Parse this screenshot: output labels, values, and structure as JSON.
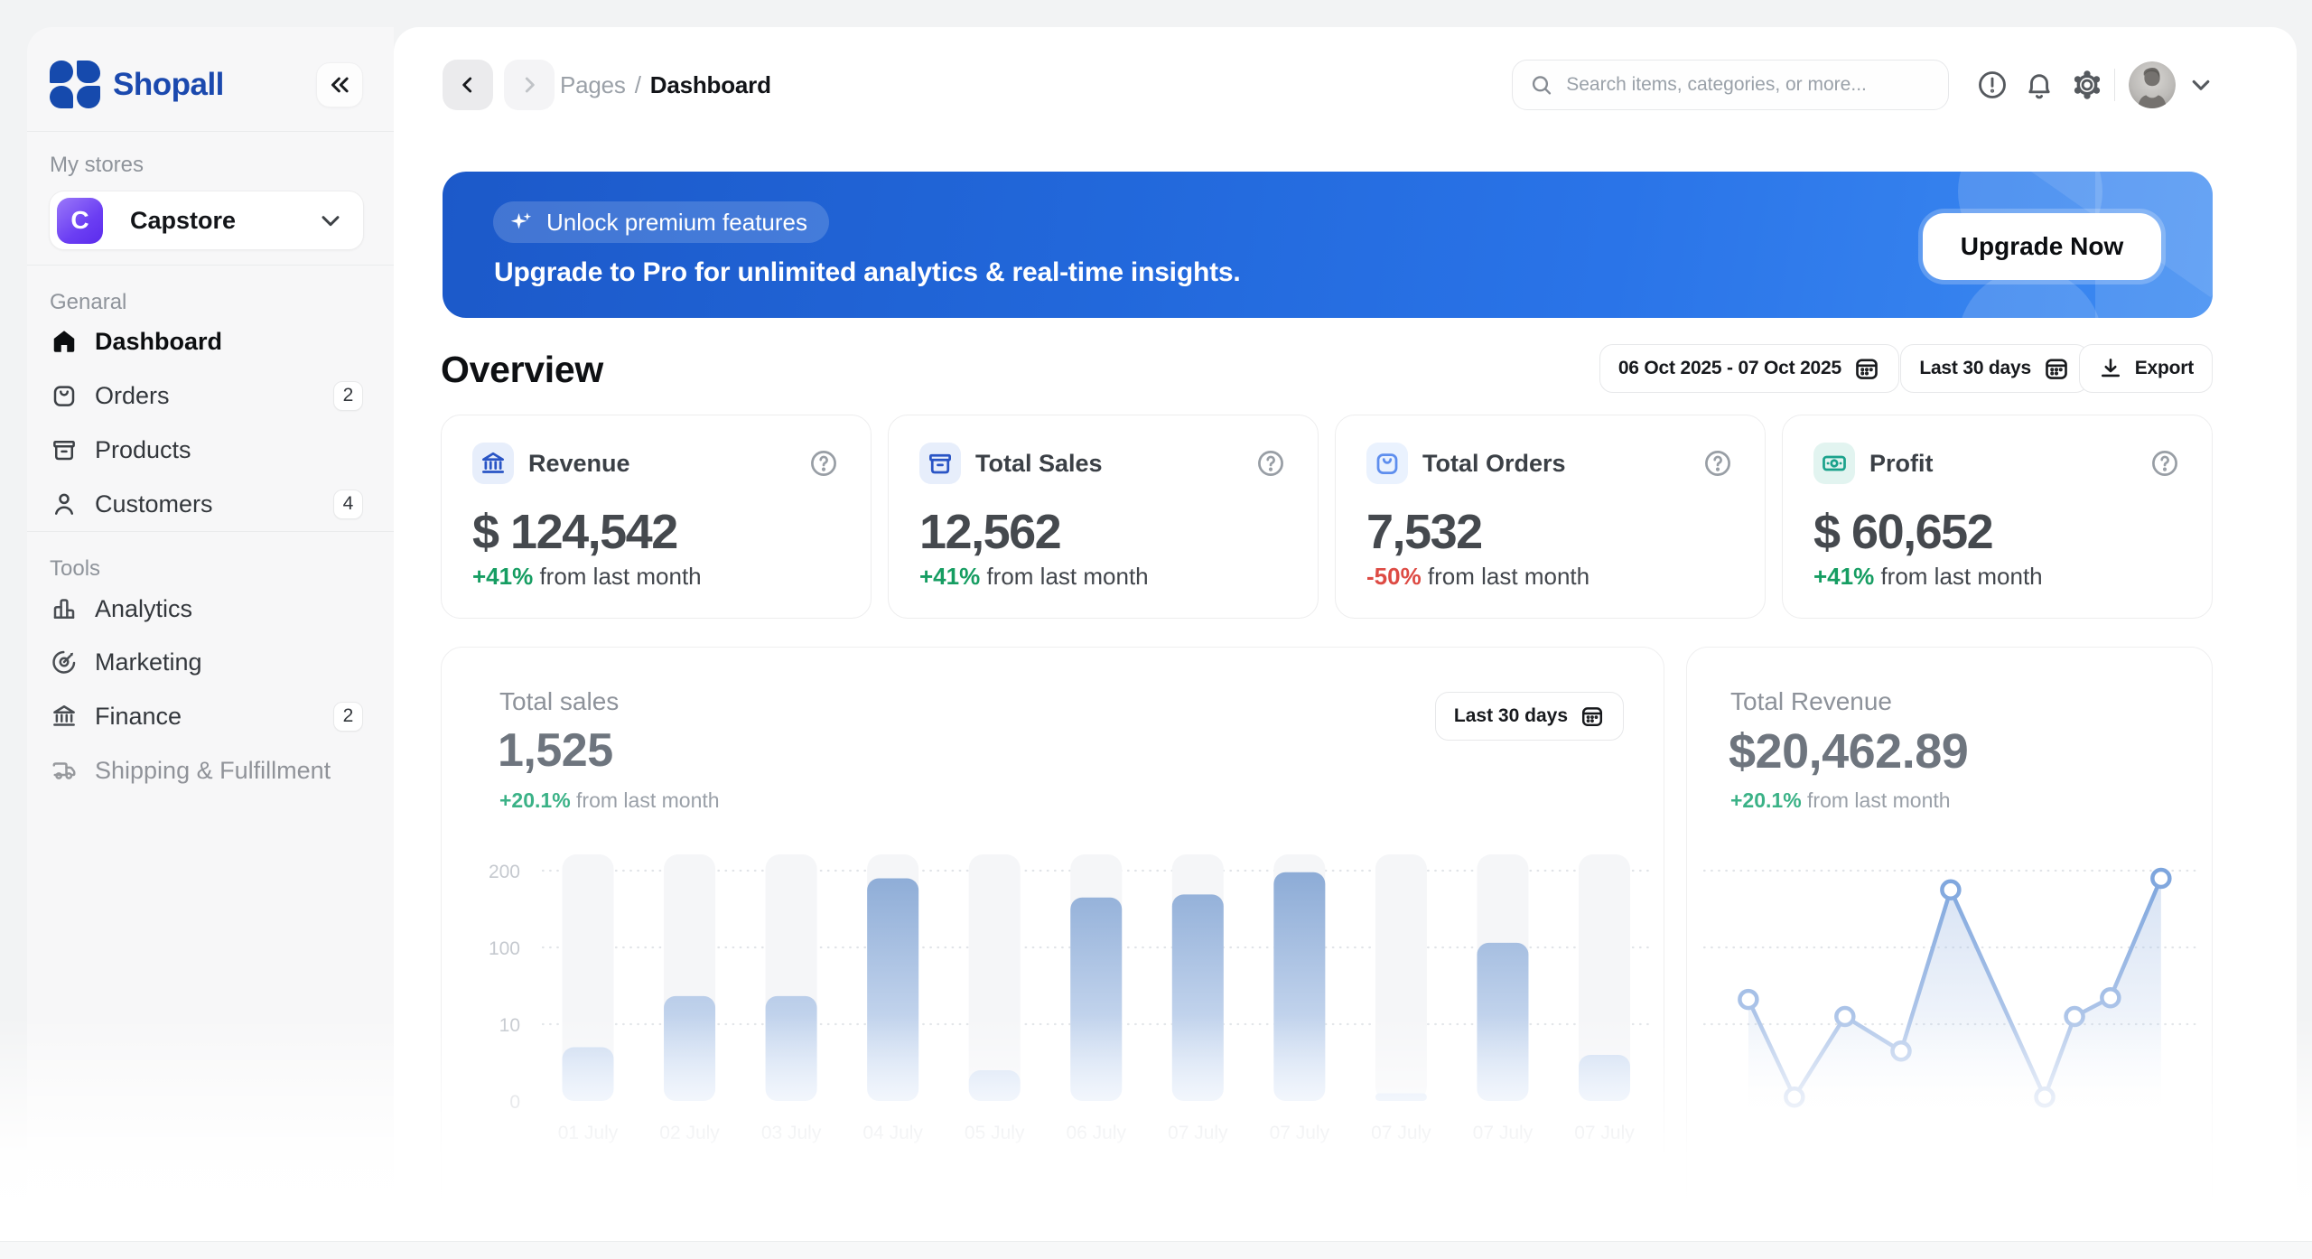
{
  "brand": {
    "name": "Shopall"
  },
  "sidebar": {
    "stores_label": "My stores",
    "store": {
      "name": "Capstore",
      "initial": "C"
    },
    "sections": [
      {
        "label": "Genaral",
        "items": [
          {
            "label": "Dashboard",
            "badge": ""
          },
          {
            "label": "Orders",
            "badge": "2"
          },
          {
            "label": "Products",
            "badge": ""
          },
          {
            "label": "Customers",
            "badge": "4"
          }
        ]
      },
      {
        "label": "Tools",
        "items": [
          {
            "label": "Analytics",
            "badge": ""
          },
          {
            "label": "Marketing",
            "badge": ""
          },
          {
            "label": "Finance",
            "badge": "2"
          },
          {
            "label": "Shipping & Fulfillment",
            "badge": ""
          }
        ]
      }
    ]
  },
  "header": {
    "breadcrumb_section": "Pages",
    "breadcrumb_sep": "/",
    "breadcrumb_page": "Dashboard",
    "search_placeholder": "Search items, categories, or more..."
  },
  "banner": {
    "pill": "Unlock premium features",
    "headline": "Upgrade to Pro for unlimited analytics & real-time insights.",
    "cta": "Upgrade Now"
  },
  "overview": {
    "title": "Overview",
    "date_range": "06 Oct 2025 - 07 Oct 2025",
    "period": "Last 30 days",
    "export_label": "Export"
  },
  "stats": [
    {
      "label": "Revenue",
      "value": "$ 124,542",
      "delta": "+41%",
      "direction": "up",
      "suffix": " from last month"
    },
    {
      "label": "Total Sales",
      "value": "12,562",
      "delta": "+41%",
      "direction": "up",
      "suffix": " from last month"
    },
    {
      "label": "Total Orders",
      "value": "7,532",
      "delta": "-50%",
      "direction": "down",
      "suffix": " from last month"
    },
    {
      "label": "Profit",
      "value": "$ 60,652",
      "delta": "+41%",
      "direction": "up",
      "suffix": " from last month"
    }
  ],
  "sales_chart": {
    "title": "Total sales",
    "value": "1,525",
    "delta": "+20.1%",
    "suffix": " from last month",
    "period": "Last 30 days"
  },
  "revenue_chart": {
    "title": "Total Revenue",
    "value": "$20,462.89",
    "delta": "+20.1%",
    "suffix": " from last month"
  },
  "chart_data": [
    {
      "type": "bar",
      "title": "Total sales",
      "categories": [
        "01 July",
        "02 July",
        "03 July",
        "04 July",
        "05 July",
        "06 July",
        "07 July",
        "07 July",
        "07 July",
        "07 July",
        "07 July"
      ],
      "values": [
        7,
        43,
        43,
        190,
        4,
        165,
        169,
        198,
        1,
        106,
        6
      ],
      "yticks": [
        200,
        100,
        10,
        0
      ],
      "ylabel": "",
      "xlabel": "",
      "grid": "dashed",
      "legend": "none"
    },
    {
      "type": "line",
      "title": "Total Revenue",
      "x_frac": [
        0.098,
        0.189,
        0.289,
        0.4,
        0.498,
        0.684,
        0.743,
        0.814,
        0.914
      ],
      "values": [
        39,
        0.5,
        19,
        6.5,
        175,
        0.5,
        19,
        41,
        190
      ],
      "yticks": [
        200,
        100,
        10
      ],
      "grid": "dashed",
      "markers": true,
      "area": true,
      "legend": "none"
    }
  ]
}
